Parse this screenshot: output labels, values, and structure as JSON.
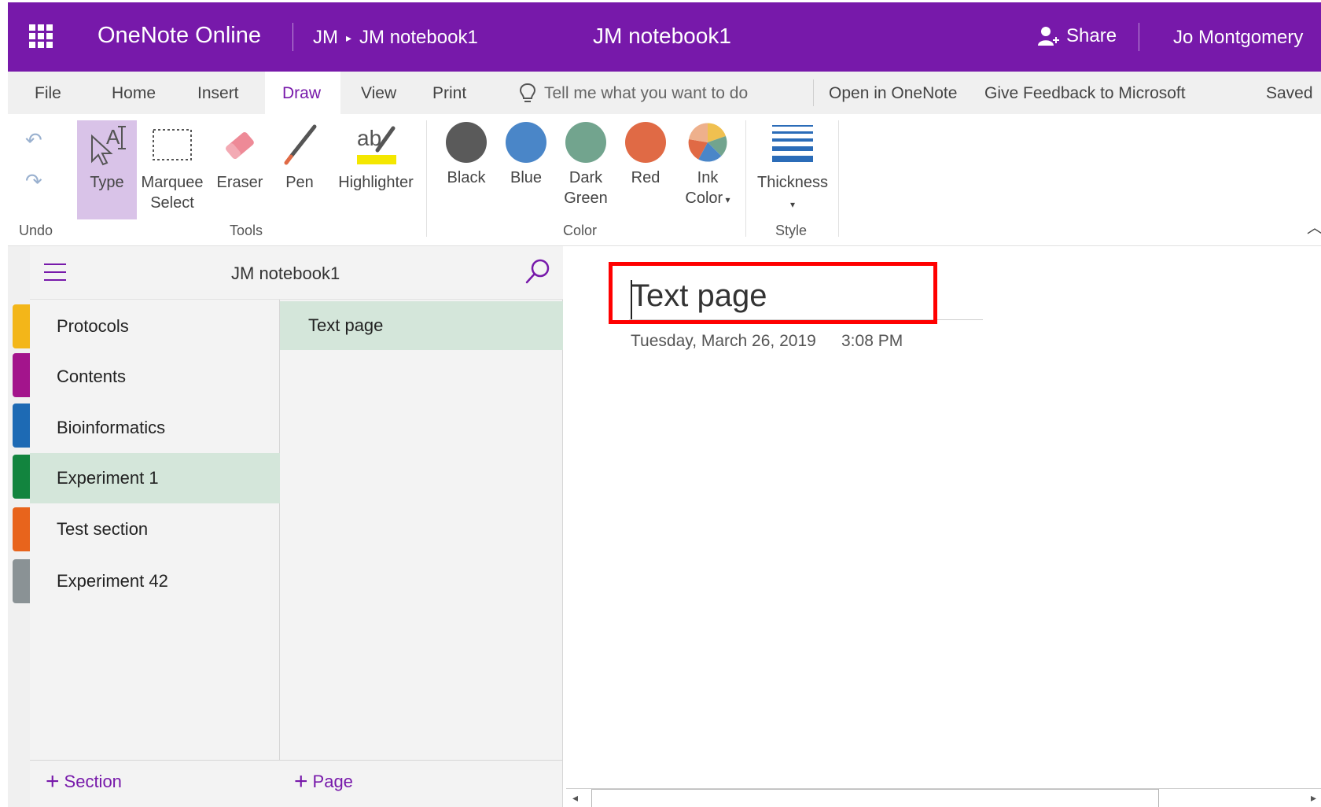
{
  "header": {
    "app_title": "OneNote Online",
    "breadcrumb_user": "JM",
    "breadcrumb_notebook": "JM notebook1",
    "notebook_title": "JM notebook1",
    "share_label": "Share",
    "user_name": "Jo Montgomery",
    "background_color": "#7719aa"
  },
  "menu": {
    "file": "File",
    "home": "Home",
    "insert": "Insert",
    "draw": "Draw",
    "view": "View",
    "print": "Print",
    "tell_me": "Tell me what you want to do",
    "open_in_onenote": "Open in OneNote",
    "feedback": "Give Feedback to Microsoft",
    "saved": "Saved",
    "active_tab": "Draw"
  },
  "ribbon": {
    "undo_group": "Undo",
    "tools_group": "Tools",
    "color_group": "Color",
    "style_group": "Style",
    "type": "Type",
    "marquee": "Marquee",
    "marquee_2": "Select",
    "eraser": "Eraser",
    "pen": "Pen",
    "highlighter": "Highlighter",
    "colors": [
      {
        "label": "Black",
        "label2": "",
        "hex": "#5a5a5a"
      },
      {
        "label": "Blue",
        "label2": "",
        "hex": "#4a86c8"
      },
      {
        "label": "Dark",
        "label2": "Green",
        "hex": "#72a48e"
      },
      {
        "label": "Red",
        "label2": "",
        "hex": "#e06a45"
      }
    ],
    "ink_color": "Ink",
    "ink_color_2": "Color",
    "thickness": "Thickness"
  },
  "sidebar": {
    "notebook_name": "JM notebook1",
    "sections": [
      {
        "label": "Protocols",
        "color": "#f3b619"
      },
      {
        "label": "Contents",
        "color": "#a3148c"
      },
      {
        "label": "Bioinformatics",
        "color": "#1d6ab4"
      },
      {
        "label": "Experiment 1",
        "color": "#12843e"
      },
      {
        "label": "Test section",
        "color": "#e8641c"
      },
      {
        "label": "Experiment 42",
        "color": "#8a9295"
      }
    ],
    "active_section": "Experiment 1",
    "add_section": "Section",
    "pages": [
      {
        "label": "Text page"
      }
    ],
    "add_page": "Page"
  },
  "page": {
    "title": "Text page",
    "date": "Tuesday, March 26, 2019",
    "time": "3:08 PM"
  }
}
